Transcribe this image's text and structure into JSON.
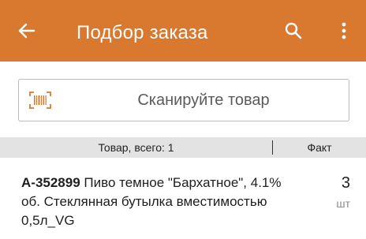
{
  "colors": {
    "appbar_bg": "#d9782f",
    "accent_barcode": "#d9782f",
    "header_bg": "#e3e3e3"
  },
  "appbar": {
    "title": "Подбор заказа",
    "back_icon": "arrow-left-icon",
    "search_icon": "search-icon",
    "more_icon": "more-vert-icon"
  },
  "scan": {
    "icon": "barcode-icon",
    "placeholder": "Сканируйте товар"
  },
  "table": {
    "columns": {
      "goods": "Товар, всего: 1",
      "fact": "Факт"
    },
    "rows": [
      {
        "code": "А-352899",
        "name": " Пиво темное \"Бархатное\", 4.1% об. Стеклянная бутылка вместимостью 0,5л_VG",
        "qty": "3",
        "unit": "шт"
      }
    ]
  }
}
